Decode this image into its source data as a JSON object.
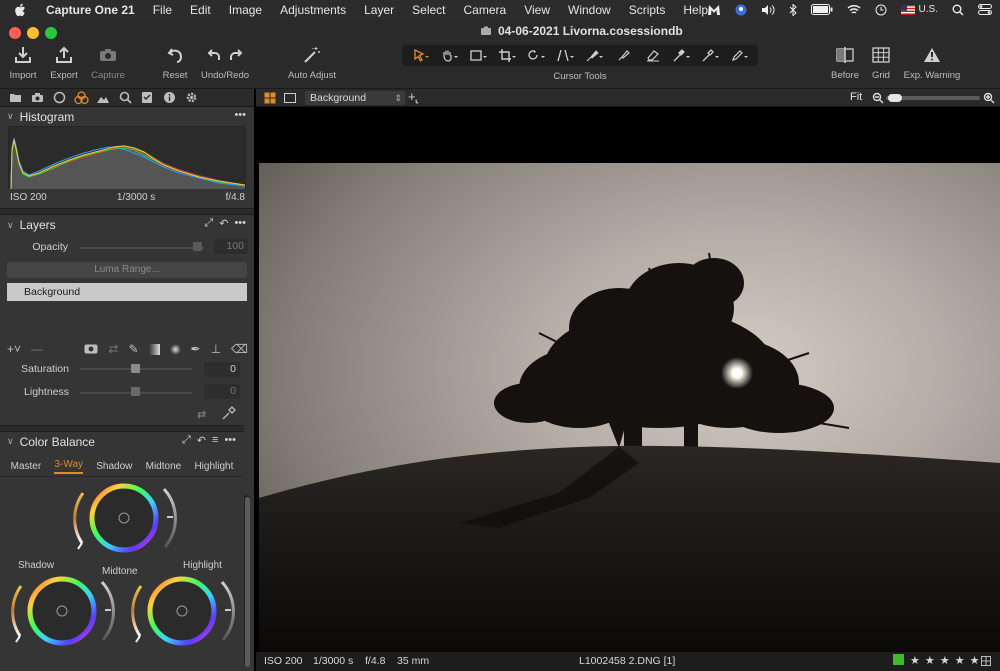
{
  "menubar": {
    "app_name": "Capture One 21",
    "items": [
      "File",
      "Edit",
      "Image",
      "Adjustments",
      "Layer",
      "Select",
      "Camera",
      "View",
      "Window",
      "Scripts",
      "Help"
    ],
    "input_source": "U.S."
  },
  "window": {
    "document_title": "04-06-2021 Livorna.cosessiondb"
  },
  "toolbar": {
    "import": "Import",
    "export": "Export",
    "capture": "Capture",
    "reset": "Reset",
    "undo_redo": "Undo/Redo",
    "auto_adjust": "Auto Adjust",
    "cursor_tools": "Cursor Tools",
    "before": "Before",
    "grid": "Grid",
    "exp_warning": "Exp. Warning"
  },
  "histogram": {
    "title": "Histogram",
    "iso": "ISO 200",
    "shutter": "1/3000 s",
    "aperture": "f/4.8"
  },
  "layers": {
    "title": "Layers",
    "opacity_label": "Opacity",
    "opacity_value": "100",
    "luma_range": "Luma Range...",
    "items": [
      "Background"
    ]
  },
  "hsl": {
    "saturation_label": "Saturation",
    "saturation_value": "0",
    "lightness_label": "Lightness",
    "lightness_value": "0"
  },
  "color_balance": {
    "title": "Color Balance",
    "tabs": [
      "Master",
      "3-Way",
      "Shadow",
      "Midtone",
      "Highlight"
    ],
    "active_tab": "3-Way",
    "wheels": {
      "shadow": "Shadow",
      "midtone": "Midtone",
      "highlight": "Highlight"
    }
  },
  "viewer": {
    "layer_select": "Background",
    "zoom_label": "Fit",
    "zoom_level": 0.02
  },
  "status": {
    "iso": "ISO 200",
    "shutter": "1/3000 s",
    "aperture": "f/4.8",
    "focal": "35 mm",
    "filename": "L1002458 2.DNG [1]",
    "color_tag": "#3dbb2a",
    "stars": "★ ★ ★ ★ ★",
    "rating": 5
  },
  "colors": {
    "accent": "#e08a2a",
    "panel_bg": "#353536",
    "toolbar_bg": "#2a2a2b"
  }
}
